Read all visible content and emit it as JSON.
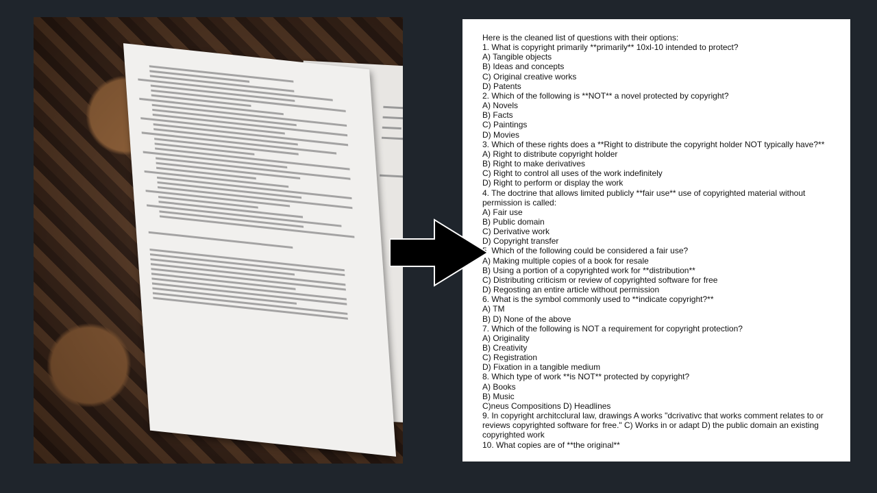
{
  "document": {
    "lines": [
      "Here is the cleaned list of questions with their options:",
      "1. What is copyright primarily **primarily** 10xl-10 intended to protect?",
      "A) Tangible objects",
      "B) Ideas and concepts",
      "C) Original creative works",
      "D) Patents",
      "2. Which of the following is **NOT** a novel protected by copyright?",
      "A) Novels",
      "B) Facts",
      "C) Paintings",
      "D) Movies",
      "3. Which of these rights does a **Right to distribute the copyright holder NOT typically have?**",
      "A) Right to distribute copyright holder",
      "B) Right to make derivatives",
      "C) Right to control all uses of the work indefinitely",
      "D) Right to perform or display the work",
      "4. The doctrine that allows limited publicly **fair use** use of copyrighted material without permission is called:",
      "A) Fair use",
      "B) Public domain",
      "C) Derivative work",
      "D) Copyright transfer",
      "5. Which of the following could be considered a fair use?",
      "A) Making multiple copies of a book for resale",
      "B) Using a portion of a copyrighted work for **distribution**",
      "C) Distributing criticism or review of copyrighted software for free",
      "D) Regosting an entire article without permission",
      "6. What is the symbol commonly used to **indicate copyright?**",
      "A) TM",
      "B) D) None of the above",
      "7. Which of the following is NOT a requirement for copyright protection?",
      "A) Originality",
      "B) Creativity",
      "C) Registration",
      "D) Fixation in a tangible medium",
      "8. Which type of work **is NOT** protected by copyright?",
      "A) Books",
      "B) Music",
      "C)neus Compositions D) Headlines",
      "9. In copyright architcclural law, drawings A works \"dcrivativc that works comment relates to or reviews copyrighted software for free.\" C) Works in or adapt D) the public domain an existing copyrighted work",
      "10. What copies are of **the original**"
    ]
  },
  "colors": {
    "background": "#1f252c",
    "paper": "#ffffff",
    "arrow": "#000000"
  },
  "icons": {
    "arrow": "right-arrow-icon"
  }
}
